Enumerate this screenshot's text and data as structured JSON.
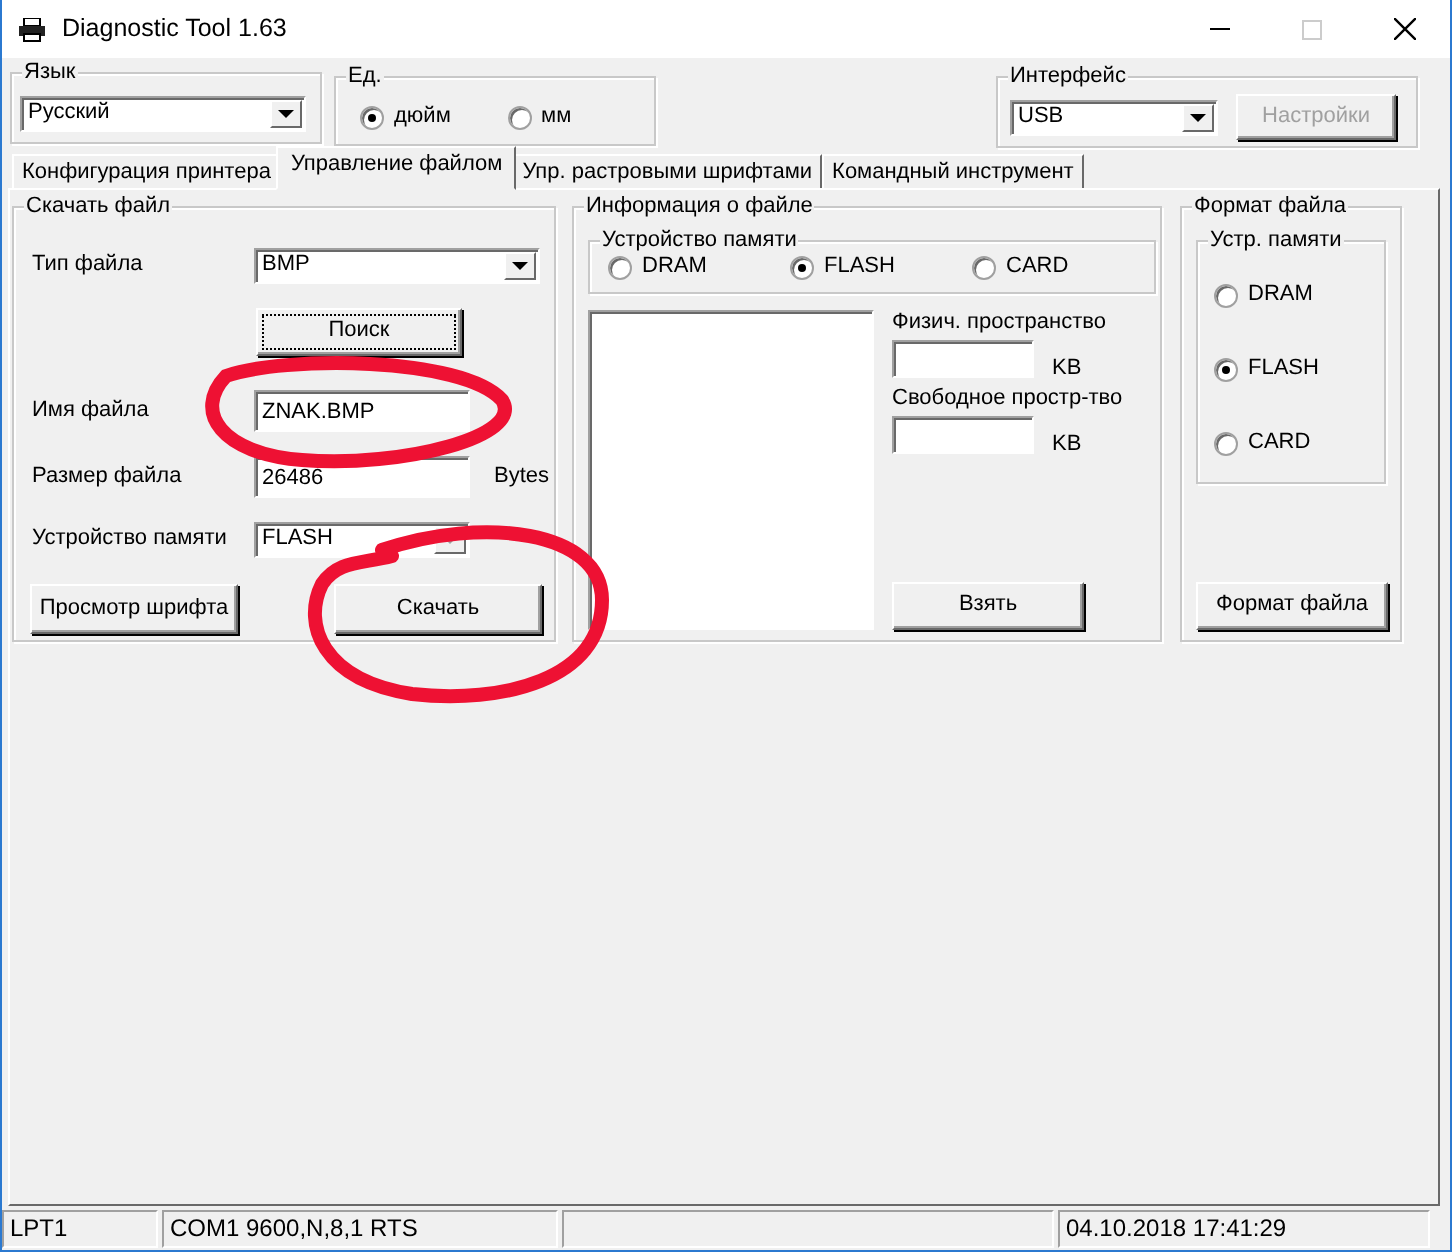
{
  "window": {
    "title": "Diagnostic Tool 1.63"
  },
  "language": {
    "label": "Язык",
    "value": "Русский"
  },
  "units": {
    "label": "Ед.",
    "options": [
      {
        "label": "дюйм",
        "selected": true
      },
      {
        "label": "мм",
        "selected": false
      }
    ]
  },
  "interface": {
    "label": "Интерфейс",
    "value": "USB",
    "settings_button": {
      "label": "Настройки",
      "disabled": true
    }
  },
  "tabs": [
    {
      "label": "Конфигурация принтера",
      "selected": false
    },
    {
      "label": "Управление файлом",
      "selected": true
    },
    {
      "label": "Упр. растровыми шрифтами",
      "selected": false
    },
    {
      "label": "Командный инструмент",
      "selected": false
    }
  ],
  "download": {
    "title": "Скачать файл",
    "fields": [
      {
        "kind": "combo",
        "label": "Тип файла",
        "value": "BMP",
        "disabled": false
      },
      {
        "kind": "button",
        "label": "Поиск",
        "focused": true
      },
      {
        "kind": "text",
        "label": "Имя файла",
        "value": "ZNAK.BMP"
      },
      {
        "kind": "text",
        "label": "Размер файла",
        "value": "26486",
        "unit": "Bytes"
      },
      {
        "kind": "combo",
        "label": "Устройство памяти",
        "value": "FLASH",
        "disabled": true
      }
    ],
    "buttons": [
      "Просмотр шрифта",
      "Скачать"
    ]
  },
  "file_info": {
    "title": "Информация о файле",
    "memory": {
      "title": "Устройство памяти",
      "options": [
        {
          "label": "DRAM",
          "selected": false
        },
        {
          "label": "FLASH",
          "selected": true
        },
        {
          "label": "CARD",
          "selected": false
        }
      ]
    },
    "spaces": [
      {
        "label": "Физич. пространство",
        "unit": "KB"
      },
      {
        "label": "Свободное простр-тво",
        "unit": "KB"
      }
    ],
    "button": "Взять"
  },
  "file_format": {
    "title": "Формат файла",
    "memory": {
      "title": "Устр. памяти",
      "options": [
        {
          "label": "DRAM",
          "selected": false
        },
        {
          "label": "FLASH",
          "selected": true
        },
        {
          "label": "CARD",
          "selected": false
        }
      ]
    },
    "button": "Формат файла"
  },
  "status_bar": {
    "left": [
      "LPT1",
      "COM1 9600,N,8,1 RTS"
    ],
    "right": [
      "04.10.2018 17:41:29"
    ]
  }
}
